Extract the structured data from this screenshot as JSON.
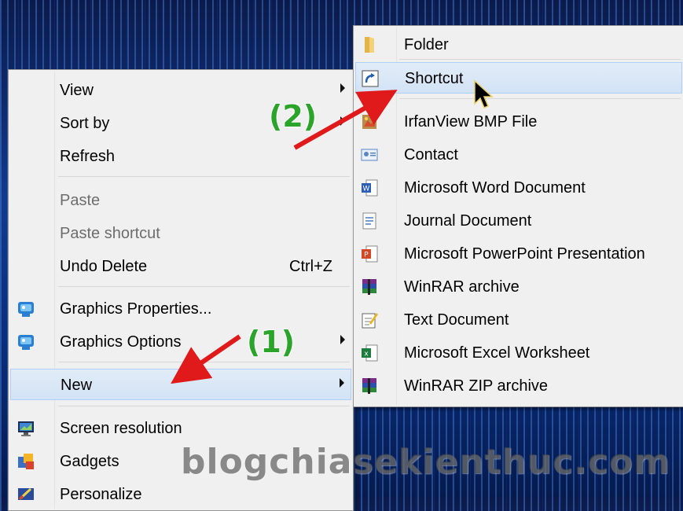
{
  "context_menu": {
    "items": [
      {
        "label": "View",
        "submenu": true,
        "enabled": true
      },
      {
        "label": "Sort by",
        "submenu": true,
        "enabled": true
      },
      {
        "label": "Refresh",
        "enabled": true
      },
      {
        "label": "Paste",
        "enabled": false
      },
      {
        "label": "Paste shortcut",
        "enabled": false
      },
      {
        "label": "Undo Delete",
        "shortcut": "Ctrl+Z",
        "enabled": true
      },
      {
        "label": "Graphics Properties...",
        "icon": "intel-graphics-icon",
        "enabled": true
      },
      {
        "label": "Graphics Options",
        "icon": "intel-graphics-icon",
        "submenu": true,
        "enabled": true
      },
      {
        "label": "New",
        "submenu": true,
        "highlighted": true,
        "enabled": true
      },
      {
        "label": "Screen resolution",
        "icon": "display-icon",
        "enabled": true
      },
      {
        "label": "Gadgets",
        "icon": "gadgets-icon",
        "enabled": true
      },
      {
        "label": "Personalize",
        "icon": "personalize-icon",
        "enabled": true
      }
    ]
  },
  "new_submenu": {
    "items": [
      {
        "label": "Folder",
        "icon": "folder-icon"
      },
      {
        "label": "Shortcut",
        "icon": "shortcut-icon",
        "highlighted": true
      },
      {
        "label": "IrfanView BMP File",
        "icon": "bmp-file-icon"
      },
      {
        "label": "Contact",
        "icon": "contact-card-icon"
      },
      {
        "label": "Microsoft Word Document",
        "icon": "word-document-icon"
      },
      {
        "label": "Journal Document",
        "icon": "journal-document-icon"
      },
      {
        "label": "Microsoft PowerPoint Presentation",
        "icon": "powerpoint-icon"
      },
      {
        "label": "WinRAR archive",
        "icon": "winrar-icon"
      },
      {
        "label": "Text Document",
        "icon": "text-document-icon"
      },
      {
        "label": "Microsoft Excel Worksheet",
        "icon": "excel-icon"
      },
      {
        "label": "WinRAR ZIP archive",
        "icon": "winrar-zip-icon"
      }
    ]
  },
  "annotations": {
    "step1": "(1)",
    "step2": "(2)",
    "arrow_color": "#e0191b",
    "label_color": "#2aa52a"
  },
  "watermark": "blogchiasekienthuc.com",
  "colors": {
    "highlight": "#d3e3f6",
    "highlight_border": "#aecff7",
    "menu_bg": "#f0f0f0"
  }
}
